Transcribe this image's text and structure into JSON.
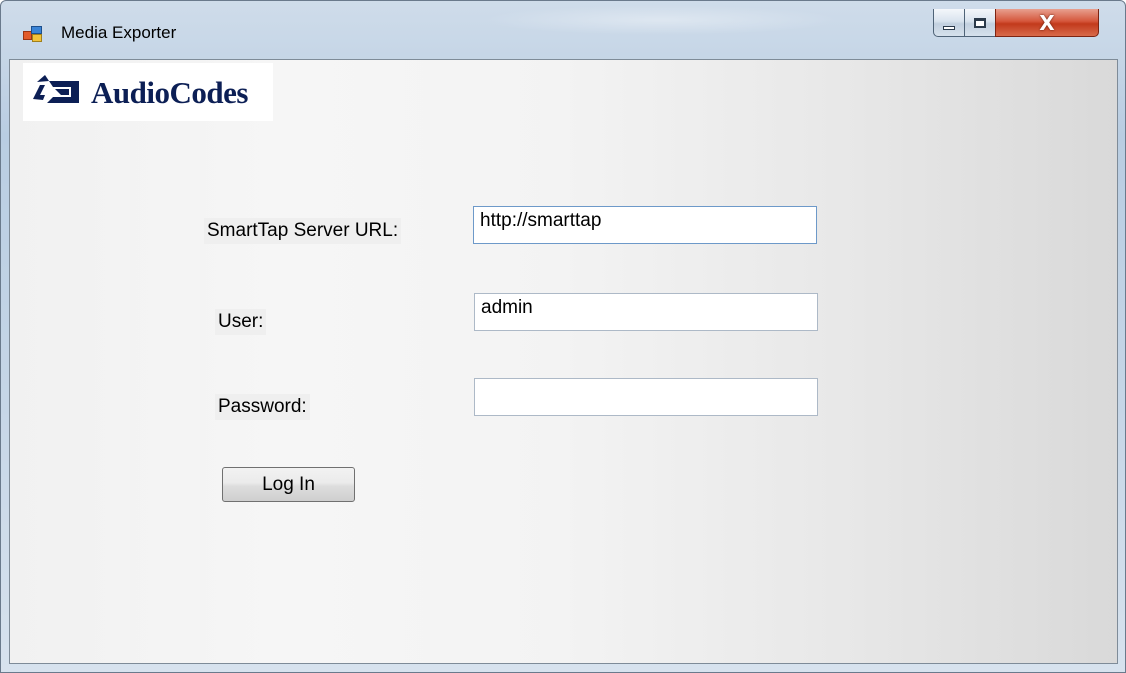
{
  "window": {
    "title": "Media Exporter",
    "controls": {
      "minimize_icon": "minimize-icon",
      "maximize_icon": "maximize-icon",
      "close_icon": "close-icon",
      "close_glyph": "X"
    }
  },
  "logo": {
    "text": "AudioCodes"
  },
  "form": {
    "server_url_label": "SmartTap Server URL:",
    "server_url_value": "http://smarttap",
    "user_label": "User:",
    "user_value": "admin",
    "password_label": "Password:",
    "password_value": "",
    "login_button": "Log In"
  },
  "colors": {
    "logo_blue": "#0c1f55",
    "close_red": "#c23a1c"
  }
}
